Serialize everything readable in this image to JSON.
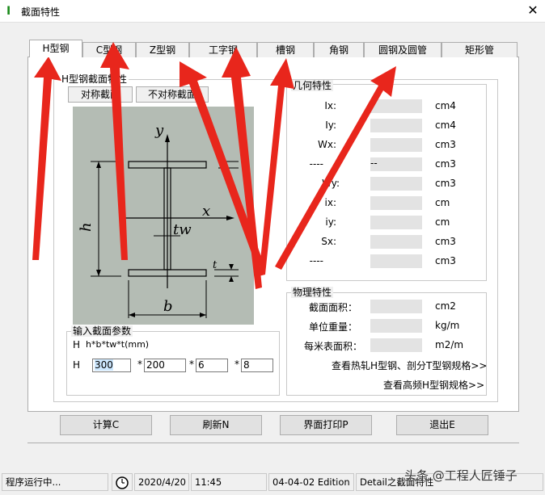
{
  "window": {
    "title": "截面特性",
    "close_glyph": "✕"
  },
  "tabs": [
    "H型钢",
    "C型钢",
    "Z型钢",
    "工字钢",
    "槽钢",
    "角钢",
    "圆钢及圆管",
    "矩形管"
  ],
  "section_group": {
    "title": "H型钢截面特性",
    "symmetric_btn": "对称截面",
    "asymmetric_btn": "不对称截面"
  },
  "drawing": {
    "y_label": "y",
    "x_label": "x",
    "h_label": "h",
    "tw_label": "tw",
    "b_label": "b",
    "t_label": "t"
  },
  "geometry_group": {
    "title": "几何特性",
    "rows": [
      {
        "label": "Ix:",
        "value": "",
        "unit": "cm4"
      },
      {
        "label": "Iy:",
        "value": "",
        "unit": "cm4"
      },
      {
        "label": "Wx:",
        "value": "",
        "unit": "cm3"
      },
      {
        "label": "----",
        "value": "--",
        "unit": "cm3"
      },
      {
        "label": "Wy:",
        "value": "",
        "unit": "cm3"
      },
      {
        "label": "ix:",
        "value": "",
        "unit": "cm"
      },
      {
        "label": "iy:",
        "value": "",
        "unit": "cm"
      },
      {
        "label": "Sx:",
        "value": "",
        "unit": "cm3"
      },
      {
        "label": "----",
        "value": "",
        "unit": "cm3"
      }
    ]
  },
  "physical_group": {
    "title": "物理特性",
    "rows": [
      {
        "label": "截面面积：",
        "value": "",
        "unit": "cm2"
      },
      {
        "label": "单位重量：",
        "value": "",
        "unit": "kg/m"
      },
      {
        "label": "每米表面积：",
        "value": "",
        "unit": "m2/m"
      }
    ],
    "link1": "查看热轧H型钢、剖分T型钢规格>>",
    "link2": "查看高频H型钢规格>>"
  },
  "input_group": {
    "title": "输入截面参数",
    "formula_prefix": "H",
    "formula": "h*b*tw*t(mm)",
    "row_prefix": "H",
    "values": [
      "300",
      "200",
      "6",
      "8"
    ],
    "sep": "*"
  },
  "buttons": {
    "calc": "计算C",
    "refresh": "刷新N",
    "print": "界面打印P",
    "exit": "退出E"
  },
  "status": {
    "state": "程序运行中...",
    "date": "2020/4/20",
    "time": "11:45",
    "edition": "04-04-02 Edition",
    "detail": "Detail之截面特性",
    "watermark": "头条 @工程人匠锤子"
  },
  "colors": {
    "drawing_bg": "#b4bcb4",
    "annotation_arrow": "#e8261c"
  }
}
